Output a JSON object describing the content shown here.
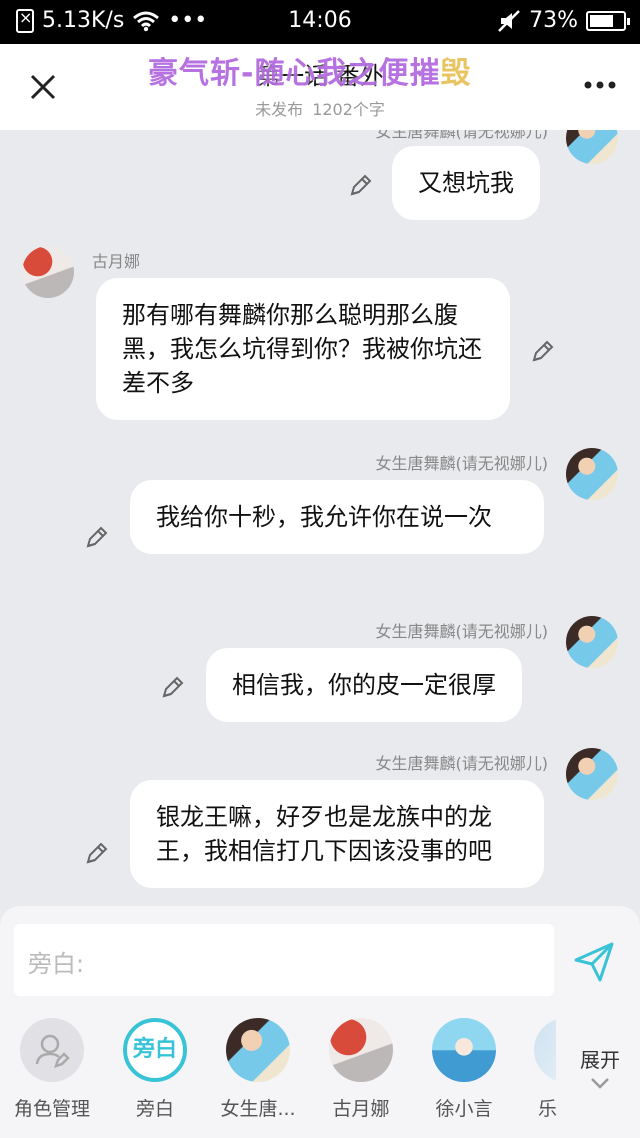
{
  "status_bar": {
    "speed": "5.13K/s",
    "dots": "•••",
    "time": "14:06",
    "battery": "73%",
    "battery_level": 0.73
  },
  "header": {
    "title": "第一话 番外",
    "subtitle_status": "未发布",
    "subtitle_count": "1202个字",
    "watermark": "豪气斩-随心我之便摧",
    "watermark_last": "毁"
  },
  "messages": [
    {
      "sender": "女生唐舞麟(请无视娜儿)",
      "text": "又想坑我",
      "side": "right"
    },
    {
      "sender": "古月娜",
      "text": "那有哪有舞麟你那么聪明那么腹黑，我怎么坑得到你？我被你坑还差不多",
      "side": "left"
    },
    {
      "sender": "女生唐舞麟(请无视娜儿)",
      "text": "我给你十秒，我允许你在说一次",
      "side": "right"
    },
    {
      "sender": "女生唐舞麟(请无视娜儿)",
      "text": "相信我，你的皮一定很厚",
      "side": "right"
    },
    {
      "sender": "女生唐舞麟(请无视娜儿)",
      "text": "银龙王嘛，好歹也是龙族中的龙王，我相信打几下因该没事的吧",
      "side": "right"
    }
  ],
  "input": {
    "placeholder": "旁白:"
  },
  "roles": [
    {
      "label": "角色管理"
    },
    {
      "label": "旁白",
      "badge": "旁白"
    },
    {
      "label": "女生唐..."
    },
    {
      "label": "古月娜"
    },
    {
      "label": "徐小言"
    },
    {
      "label": "乐"
    }
  ],
  "expand_label": "展开",
  "colors": {
    "accent": "#39c3d6",
    "background": "#e9eaee"
  }
}
